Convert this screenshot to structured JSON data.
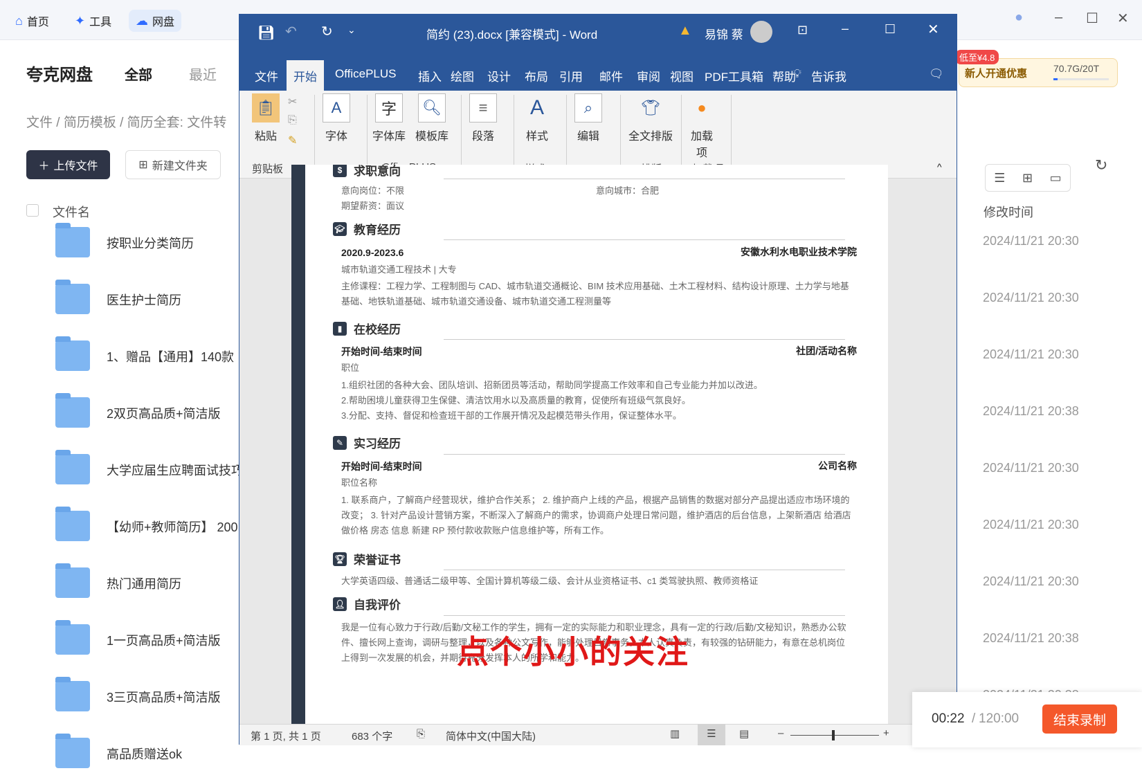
{
  "topbar": {
    "tabs": [
      {
        "label": "首页",
        "icon": "home-icon"
      },
      {
        "label": "工具",
        "icon": "tools-icon"
      },
      {
        "label": "网盘",
        "icon": "cloud-icon",
        "active": true
      }
    ]
  },
  "left": {
    "title": "夸克网盘",
    "tabs": [
      "全部",
      "最近"
    ],
    "breadcrumb": "文件 / 简历模板 / 简历全套: 文件转",
    "upload": "上传文件",
    "new_folder": "新建文件夹",
    "col_name": "文件名",
    "col_time": "修改时间",
    "files": [
      {
        "name": "按职业分类简历",
        "time": "2024/11/21 20:30"
      },
      {
        "name": "医生护士简历",
        "time": "2024/11/21 20:30"
      },
      {
        "name": "1、赠品【通用】140款",
        "time": "2024/11/21 20:30"
      },
      {
        "name": "2双页高品质+简洁版",
        "time": "2024/11/21 20:38"
      },
      {
        "name": "大学应届生应聘面试技巧",
        "time": "2024/11/21 20:30"
      },
      {
        "name": "【幼师+教师简历】 200",
        "time": "2024/11/21 20:30"
      },
      {
        "name": "热门通用简历",
        "time": "2024/11/21 20:30"
      },
      {
        "name": "1一页高品质+简洁版",
        "time": "2024/11/21 20:38"
      },
      {
        "name": "3三页高品质+简洁版",
        "time": "2024/11/21 20:38"
      },
      {
        "name": "高品质赠送ok",
        "time": ""
      }
    ]
  },
  "promo": {
    "badge": "低至¥4.8",
    "label": "新人开通优惠",
    "storage": "70.7G/20T",
    "storage_fraction": 0.0035
  },
  "word": {
    "title": "简约 (23).docx [兼容模式] - Word",
    "user": "易锦 蔡",
    "tabs": [
      "文件",
      "开始",
      "OfficePLUS",
      "插入",
      "绘图",
      "设计",
      "布局",
      "引用",
      "邮件",
      "审阅",
      "视图",
      "PDF工具箱",
      "帮助",
      "告诉我"
    ],
    "ribbon": {
      "paste": "粘贴",
      "font": "字体",
      "fontlib": "字体库",
      "tpllib": "模板库",
      "para": "段落",
      "style": "样式",
      "edit": "编辑",
      "layout": "全文排版",
      "addin": "加载项",
      "g_clip": "剪贴板",
      "g_office": "OfficePLUS",
      "g_style": "样式",
      "g_layout": "排版",
      "g_addin": "加载项"
    },
    "status": {
      "page": "第 1 页, 共 1 页",
      "words": "683 个字",
      "lang": "简体中文(中国大陆)"
    }
  },
  "doc": {
    "s1": "求职意向",
    "pos": "意向岗位：不限",
    "city": "意向城市：合肥",
    "salary": "期望薪资：面议",
    "s2": "教育经历",
    "edu_date": "2020.9-2023.6",
    "school": "安徽水利水电职业技术学院",
    "major": "城市轨道交通工程技术 | 大专",
    "courses": "主修课程：工程力学、工程制图与 CAD、城市轨道交通概论、BIM 技术应用基础、土木工程材料、结构设计原理、土力学与地基基础、地铁轨道基础、城市轨道交通设备、城市轨道交通工程测量等",
    "s3": "在校经历",
    "c_date": "开始时间-结束时间",
    "club": "社团/活动名称",
    "c_role": "职位",
    "c1": "1.组织社团的各种大会、团队培训、招新团员等活动，帮助同学提高工作效率和自己专业能力并加以改进。",
    "c2": "2.帮助困境儿童获得卫生保健、清洁饮用水以及高质量的教育，促使所有班级气氛良好。",
    "c3": "3.分配、支持、督促和检查班干部的工作展开情况及起模范带头作用，保证整体水平。",
    "s4": "实习经历",
    "i_date": "开始时间-结束时间",
    "company": "公司名称",
    "i_role": "职位名称",
    "intern": "1. 联系商户，了解商户经营现状，维护合作关系； 2. 维护商户上线的产品，根据产品销售的数据对部分产品提出适应市场环境的改变； 3. 针对产品设计营销方案，不断深入了解商户的需求，协调商户处理日常问题，维护酒店的后台信息，上架新酒店 给酒店做价格 房态 信息 新建 RP 预付款收款账户信息维护等，所有工作。",
    "s5": "荣誉证书",
    "certs": "大学英语四级、普通话二级甲等、全国计算机等级二级、会计从业资格证书、c1 类驾驶执照、教师资格证",
    "s6": "自我评价",
    "self": "我是一位有心致力于行政/后勤/文秘工作的学生，拥有一定的实际能力和职业理念，具有一定的行政/后勤/文秘知识，熟悉办公软件、擅长网上查询，调研与整理，以及各种公文写作，能够处理日常事务。本人认真负责，有较强的钻研能力，有意在总机岗位上得到一次发展的机会，并期待充分发挥本人的所学和能力。"
  },
  "overlay": "点个小小的关注",
  "recorder": {
    "elapsed": "00:22",
    "total": "120:00",
    "stop": "结束录制"
  }
}
